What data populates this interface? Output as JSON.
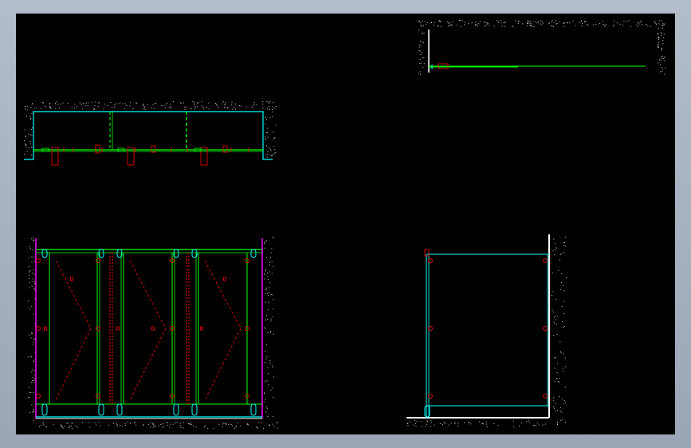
{
  "viewer": {
    "background": "#000000",
    "frame_color": "#9aa6b6"
  },
  "drawing": {
    "colors": {
      "wall": "#ffffff",
      "glass": "#00ffff",
      "frame": "#00ff00",
      "hardware": "#ff0000",
      "side_panel": "#ff00ff",
      "hatch": "#cccccc"
    },
    "views": [
      {
        "name": "plan-view"
      },
      {
        "name": "top-detail-view"
      },
      {
        "name": "front-elevation-view"
      },
      {
        "name": "side-elevation-view"
      }
    ]
  }
}
